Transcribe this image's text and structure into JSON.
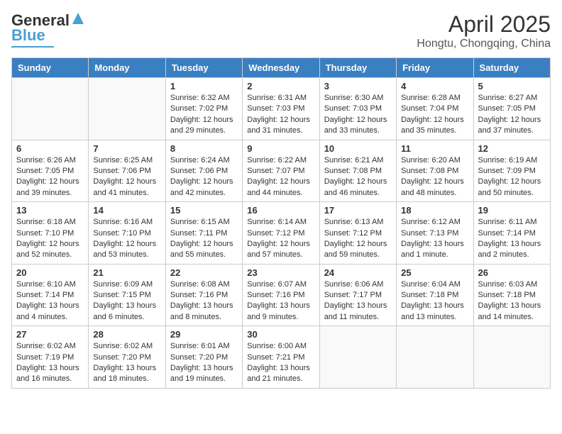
{
  "header": {
    "logo_general": "General",
    "logo_blue": "Blue",
    "title": "April 2025",
    "subtitle": "Hongtu, Chongqing, China"
  },
  "days_of_week": [
    "Sunday",
    "Monday",
    "Tuesday",
    "Wednesday",
    "Thursday",
    "Friday",
    "Saturday"
  ],
  "weeks": [
    [
      {
        "day": "",
        "info": ""
      },
      {
        "day": "",
        "info": ""
      },
      {
        "day": "1",
        "info": "Sunrise: 6:32 AM\nSunset: 7:02 PM\nDaylight: 12 hours and 29 minutes."
      },
      {
        "day": "2",
        "info": "Sunrise: 6:31 AM\nSunset: 7:03 PM\nDaylight: 12 hours and 31 minutes."
      },
      {
        "day": "3",
        "info": "Sunrise: 6:30 AM\nSunset: 7:03 PM\nDaylight: 12 hours and 33 minutes."
      },
      {
        "day": "4",
        "info": "Sunrise: 6:28 AM\nSunset: 7:04 PM\nDaylight: 12 hours and 35 minutes."
      },
      {
        "day": "5",
        "info": "Sunrise: 6:27 AM\nSunset: 7:05 PM\nDaylight: 12 hours and 37 minutes."
      }
    ],
    [
      {
        "day": "6",
        "info": "Sunrise: 6:26 AM\nSunset: 7:05 PM\nDaylight: 12 hours and 39 minutes."
      },
      {
        "day": "7",
        "info": "Sunrise: 6:25 AM\nSunset: 7:06 PM\nDaylight: 12 hours and 41 minutes."
      },
      {
        "day": "8",
        "info": "Sunrise: 6:24 AM\nSunset: 7:06 PM\nDaylight: 12 hours and 42 minutes."
      },
      {
        "day": "9",
        "info": "Sunrise: 6:22 AM\nSunset: 7:07 PM\nDaylight: 12 hours and 44 minutes."
      },
      {
        "day": "10",
        "info": "Sunrise: 6:21 AM\nSunset: 7:08 PM\nDaylight: 12 hours and 46 minutes."
      },
      {
        "day": "11",
        "info": "Sunrise: 6:20 AM\nSunset: 7:08 PM\nDaylight: 12 hours and 48 minutes."
      },
      {
        "day": "12",
        "info": "Sunrise: 6:19 AM\nSunset: 7:09 PM\nDaylight: 12 hours and 50 minutes."
      }
    ],
    [
      {
        "day": "13",
        "info": "Sunrise: 6:18 AM\nSunset: 7:10 PM\nDaylight: 12 hours and 52 minutes."
      },
      {
        "day": "14",
        "info": "Sunrise: 6:16 AM\nSunset: 7:10 PM\nDaylight: 12 hours and 53 minutes."
      },
      {
        "day": "15",
        "info": "Sunrise: 6:15 AM\nSunset: 7:11 PM\nDaylight: 12 hours and 55 minutes."
      },
      {
        "day": "16",
        "info": "Sunrise: 6:14 AM\nSunset: 7:12 PM\nDaylight: 12 hours and 57 minutes."
      },
      {
        "day": "17",
        "info": "Sunrise: 6:13 AM\nSunset: 7:12 PM\nDaylight: 12 hours and 59 minutes."
      },
      {
        "day": "18",
        "info": "Sunrise: 6:12 AM\nSunset: 7:13 PM\nDaylight: 13 hours and 1 minute."
      },
      {
        "day": "19",
        "info": "Sunrise: 6:11 AM\nSunset: 7:14 PM\nDaylight: 13 hours and 2 minutes."
      }
    ],
    [
      {
        "day": "20",
        "info": "Sunrise: 6:10 AM\nSunset: 7:14 PM\nDaylight: 13 hours and 4 minutes."
      },
      {
        "day": "21",
        "info": "Sunrise: 6:09 AM\nSunset: 7:15 PM\nDaylight: 13 hours and 6 minutes."
      },
      {
        "day": "22",
        "info": "Sunrise: 6:08 AM\nSunset: 7:16 PM\nDaylight: 13 hours and 8 minutes."
      },
      {
        "day": "23",
        "info": "Sunrise: 6:07 AM\nSunset: 7:16 PM\nDaylight: 13 hours and 9 minutes."
      },
      {
        "day": "24",
        "info": "Sunrise: 6:06 AM\nSunset: 7:17 PM\nDaylight: 13 hours and 11 minutes."
      },
      {
        "day": "25",
        "info": "Sunrise: 6:04 AM\nSunset: 7:18 PM\nDaylight: 13 hours and 13 minutes."
      },
      {
        "day": "26",
        "info": "Sunrise: 6:03 AM\nSunset: 7:18 PM\nDaylight: 13 hours and 14 minutes."
      }
    ],
    [
      {
        "day": "27",
        "info": "Sunrise: 6:02 AM\nSunset: 7:19 PM\nDaylight: 13 hours and 16 minutes."
      },
      {
        "day": "28",
        "info": "Sunrise: 6:02 AM\nSunset: 7:20 PM\nDaylight: 13 hours and 18 minutes."
      },
      {
        "day": "29",
        "info": "Sunrise: 6:01 AM\nSunset: 7:20 PM\nDaylight: 13 hours and 19 minutes."
      },
      {
        "day": "30",
        "info": "Sunrise: 6:00 AM\nSunset: 7:21 PM\nDaylight: 13 hours and 21 minutes."
      },
      {
        "day": "",
        "info": ""
      },
      {
        "day": "",
        "info": ""
      },
      {
        "day": "",
        "info": ""
      }
    ]
  ]
}
